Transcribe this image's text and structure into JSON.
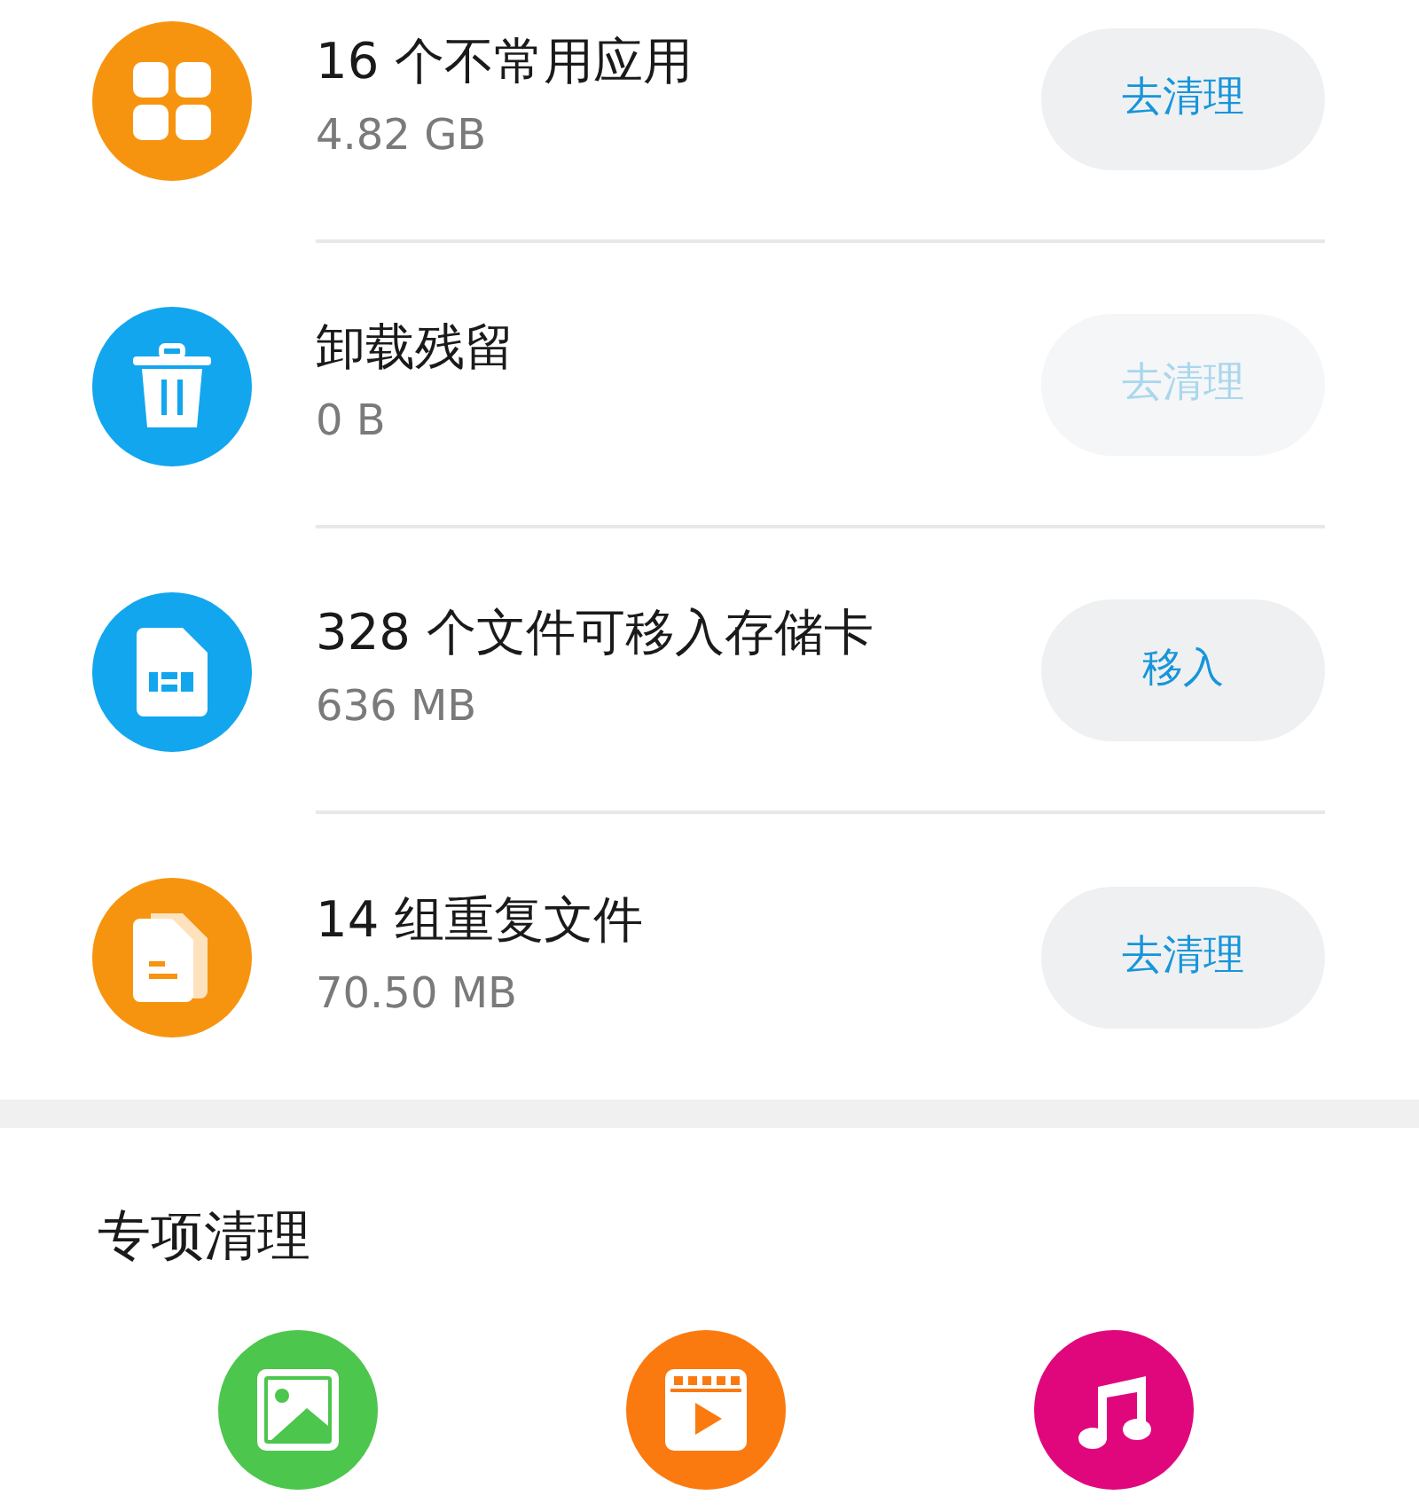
{
  "items": [
    {
      "kind": "apps",
      "title": "16 个不常用应用",
      "size": "4.82 GB",
      "action": "去清理",
      "disabled": false
    },
    {
      "kind": "trash",
      "title": "卸载残留",
      "size": "0 B",
      "action": "去清理",
      "disabled": true
    },
    {
      "kind": "sdcard",
      "title": "328 个文件可移入存储卡",
      "size": "636 MB",
      "action": "移入",
      "disabled": false
    },
    {
      "kind": "duplicate",
      "title": "14 组重复文件",
      "size": "70.50 MB",
      "action": "去清理",
      "disabled": false
    }
  ],
  "special": {
    "heading": "专项清理",
    "items": [
      {
        "kind": "image"
      },
      {
        "kind": "video"
      },
      {
        "kind": "music"
      }
    ]
  }
}
